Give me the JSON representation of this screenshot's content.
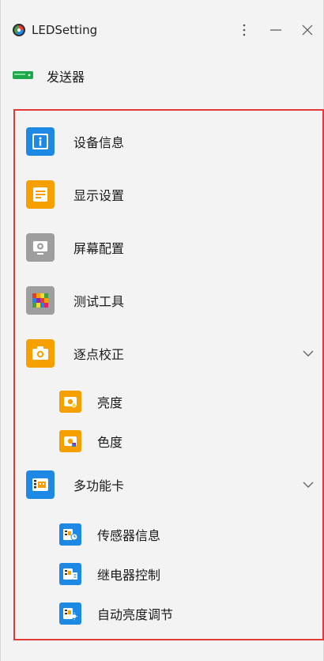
{
  "app": {
    "title": "LEDSetting"
  },
  "device": {
    "label": "发送器"
  },
  "nav": {
    "device_info": "设备信息",
    "display_settings": "显示设置",
    "screen_config": "屏幕配置",
    "test_tools": "测试工具",
    "calibration": {
      "label": "逐点校正",
      "children": {
        "brightness": "亮度",
        "chroma": "色度"
      }
    },
    "multi_card": {
      "label": "多功能卡",
      "children": {
        "sensor_info": "传感器信息",
        "relay_control": "继电器控制",
        "auto_brightness": "自动亮度调节"
      }
    }
  },
  "colors": {
    "blue": "#1e88e5",
    "orange": "#f6a000",
    "gray": "#9e9e9e",
    "highlight_border": "#e53935",
    "device_green": "#1ea84a"
  }
}
